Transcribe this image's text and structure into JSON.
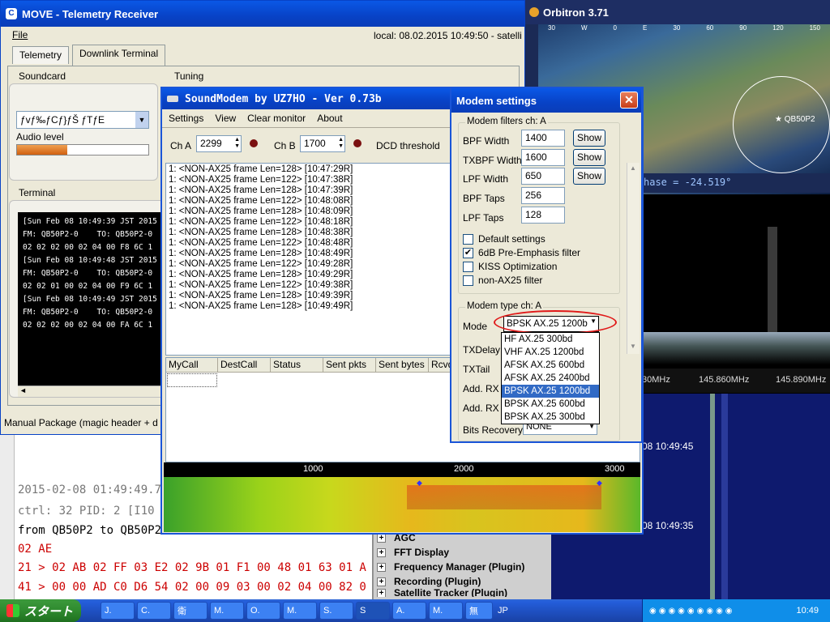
{
  "move": {
    "title": "MOVE - Telemetry Receiver",
    "menu_file": "File",
    "local_time": "local: 08.02.2015 10:49:50 - satelli",
    "tabs": [
      "Telemetry",
      "Downlink Terminal"
    ],
    "soundcard_label": "Soundcard",
    "tuning_label": "Tuning",
    "soundcard_value": "ƒvƒ‰ƒCƒ}ƒŠ ƒTƒE",
    "audio_level_label": "Audio level",
    "audio_level": 0.38,
    "terminal_label": "Terminal",
    "terminal_lines": [
      "[Sun Feb 08 10:49:39 JST 2015",
      "FM: QB50P2-0    TO: QB50P2-0",
      "02 02 02 00 02 04 00 F8 6C 1",
      "",
      "[Sun Feb 08 10:49:48 JST 2015",
      "FM: QB50P2-0    TO: QB50P2-0",
      "02 02 01 00 02 04 00 F9 6C 1",
      "",
      "[Sun Feb 08 10:49:49 JST 2015",
      "FM: QB50P2-0    TO: QB50P2-0",
      "02 02 02 00 02 04 00 FA 6C 1"
    ],
    "manual_package": "Manual Package (magic header + d"
  },
  "log": {
    "lines": [
      "2015-02-08 01:49:49.77",
      "ctrl: 32   PID: 2 [I10",
      "from QB50P2 to QB50P2",
      "02 AE",
      "  21 > 02 AB 02 FF 03 E2 02 9B 01 F1 00 48 01 63 01 A",
      "  41 > 00 00 AD C0 D6 54 02 00 09 03 00 02 04 00 82 0"
    ]
  },
  "plugins": [
    "AGC",
    "FFT Display",
    "Frequency Manager (Plugin)",
    "Recording (Plugin)",
    "Satellite Tracker (Plugin)"
  ],
  "orbitron": {
    "title": "Orbitron 3.71",
    "axis_labels": [
      "30",
      "W",
      "0",
      "E",
      "30",
      "60",
      "90",
      "120",
      "150"
    ],
    "sat_label": "QB50P2",
    "phase": "hase = -24.519°"
  },
  "sdr": {
    "freq_labels": [
      "30MHz",
      "145.860MHz",
      "145.890MHz"
    ],
    "wf_times": [
      "08 10:49:45",
      "08 10:49:35"
    ]
  },
  "soundmodem": {
    "title": "SoundModem by UZ7HO - Ver 0.73b",
    "menu": [
      "Settings",
      "View",
      "Clear monitor",
      "About"
    ],
    "cha_label": "Ch A",
    "cha_value": "2299",
    "chb_label": "Ch B",
    "chb_value": "1700",
    "dcd_label": "DCD threshold",
    "log_lines": [
      "1: <NON-AX25 frame Len=128> [10:47:29R]",
      "1: <NON-AX25 frame Len=122> [10:47:38R]",
      "1: <NON-AX25 frame Len=128> [10:47:39R]",
      "1: <NON-AX25 frame Len=122> [10:48:08R]",
      "1: <NON-AX25 frame Len=128> [10:48:09R]",
      "1: <NON-AX25 frame Len=122> [10:48:18R]",
      "1: <NON-AX25 frame Len=128> [10:48:38R]",
      "1: <NON-AX25 frame Len=122> [10:48:48R]",
      "1: <NON-AX25 frame Len=128> [10:48:49R]",
      "1: <NON-AX25 frame Len=122> [10:49:28R]",
      "1: <NON-AX25 frame Len=128> [10:49:29R]",
      "1: <NON-AX25 frame Len=122> [10:49:38R]",
      "1: <NON-AX25 frame Len=128> [10:49:39R]",
      "1: <NON-AX25 frame Len=128> [10:49:49R]"
    ],
    "table_headers": [
      "MyCall",
      "DestCall",
      "Status",
      "Sent pkts",
      "Sent bytes",
      "Rcvd"
    ],
    "scale": [
      "1000",
      "2000",
      "3000"
    ]
  },
  "modem_settings": {
    "title": "Modem settings",
    "filters_group": "Modem filters ch: A",
    "bpf_width_label": "BPF Width",
    "bpf_width": "1400",
    "txbpf_width_label": "TXBPF Width",
    "txbpf_width": "1600",
    "lpf_width_label": "LPF Width",
    "lpf_width": "650",
    "bpf_taps_label": "BPF Taps",
    "bpf_taps": "256",
    "lpf_taps_label": "LPF Taps",
    "lpf_taps": "128",
    "show_label": "Show",
    "checkboxes": [
      {
        "label": "Default settings",
        "checked": false
      },
      {
        "label": "6dB Pre-Emphasis filter",
        "checked": true
      },
      {
        "label": "KISS Optimization",
        "checked": false
      },
      {
        "label": "non-AX25 filter",
        "checked": false
      }
    ],
    "type_group": "Modem type ch: A",
    "mode_label": "Mode",
    "mode_value": "BPSK AX.25 1200bd",
    "txdelay_label": "TXDelay",
    "txtail_label": "TXTail",
    "addrx_label": "Add. RX",
    "addrxs_label": "Add. RX s",
    "bits_recovery_label": "Bits Recovery",
    "bits_recovery_value": "NONE",
    "mode_options": [
      "HF AX.25 300bd",
      "VHF AX.25 1200bd",
      "AFSK AX.25 600bd",
      "AFSK AX.25 2400bd",
      "BPSK AX.25 1200bd",
      "BPSK AX.25 600bd",
      "BPSK AX.25 300bd"
    ],
    "selected_option": 4
  },
  "taskbar": {
    "start": "スタート",
    "items": [
      "J.",
      "C.",
      "衛",
      "M.",
      "O.",
      "M.",
      "S.",
      "S",
      "A.",
      "M.",
      "無"
    ],
    "lang": "JP",
    "clock": "10:49"
  },
  "colors": {
    "xp_blue": "#0842c6",
    "orange_level": "#e07a1f",
    "selection": "#316ac5"
  }
}
